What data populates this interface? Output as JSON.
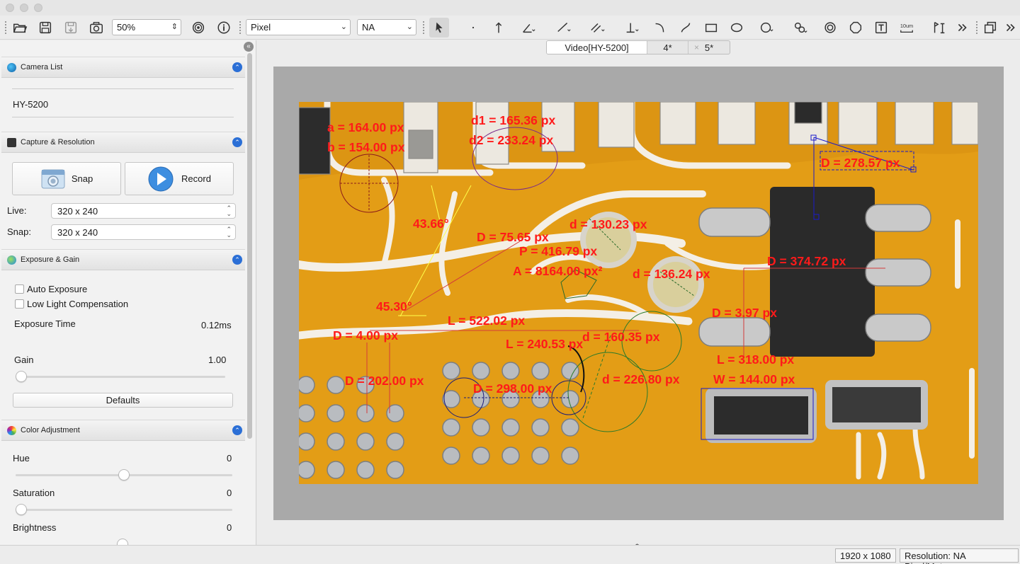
{
  "toolbar": {
    "zoom": "50%",
    "unit": "Pixel",
    "magnification": "NA",
    "icons": [
      "open-icon",
      "save-icon",
      "save-as-icon",
      "snapshot-icon",
      "target-icon",
      "info-icon",
      "select-arrow-icon",
      "point-icon",
      "arrow-line-icon",
      "angle-icon",
      "line-icon",
      "parallel-line-icon",
      "perpendicular-icon",
      "arc-icon",
      "curve-icon",
      "rectangle-icon",
      "ellipse-icon",
      "circle-icon",
      "two-circle-icon",
      "concentric-circle-icon",
      "polygon-icon",
      "text-icon",
      "scale-bar-icon",
      "calibrate-icon",
      "more-icon",
      "window-icon",
      "more-right-icon"
    ],
    "scale_bar_text": "10um"
  },
  "panel": {
    "camera_list": {
      "title": "Camera List",
      "camera": "HY-5200"
    },
    "capture": {
      "title": "Capture & Resolution",
      "snap_label": "Snap",
      "record_label": "Record",
      "live_label": "Live:",
      "live_value": "320 x 240",
      "snap_res_label": "Snap:",
      "snap_res_value": "320 x 240"
    },
    "exposure": {
      "title": "Exposure & Gain",
      "auto_exposure": "Auto Exposure",
      "low_light": "Low Light Compensation",
      "exposure_time_label": "Exposure Time",
      "exposure_time_value": "0.12ms",
      "gain_label": "Gain",
      "gain_value": "1.00",
      "gain_level": 0.0,
      "defaults_label": "Defaults"
    },
    "color": {
      "title": "Color Adjustment",
      "hue_label": "Hue",
      "hue_value": "0",
      "hue_level": 0.5,
      "saturation_label": "Saturation",
      "saturation_value": "0",
      "saturation_level": 0.0,
      "brightness_label": "Brightness",
      "brightness_value": "0"
    }
  },
  "tabs": [
    {
      "label": "Video[HY-5200]"
    },
    {
      "label": "4*"
    },
    {
      "label": "5*"
    }
  ],
  "tab_close": "×",
  "status": {
    "resolution": "1920 x 1080",
    "calibration": "Resolution: NA Pixel/Meter"
  },
  "measurements": [
    "a = 164.00 px",
    "b = 154.00 px",
    "d1 = 165.36 px",
    "d2 = 233.24 px",
    "D = 278.57 px",
    "43.66°",
    "D = 75.65 px",
    "d = 130.23 px",
    "P = 416.79 px",
    "A = 8164.00 px²",
    "d = 136.24 px",
    "D = 374.72 px",
    "45.30°",
    "L = 522.02 px",
    "D = 3.97 px",
    "D = 4.00 px",
    "d = 160.35 px",
    "L = 240.53 px",
    "L = 318.00 px",
    "D = 202.00 px",
    "d = 226.80 px",
    "W = 144.00 px",
    "D = 298.00 px"
  ],
  "colors": {
    "accent": "#2b6fd6",
    "measure": "#ff1a1a",
    "board": "#e8a218"
  }
}
